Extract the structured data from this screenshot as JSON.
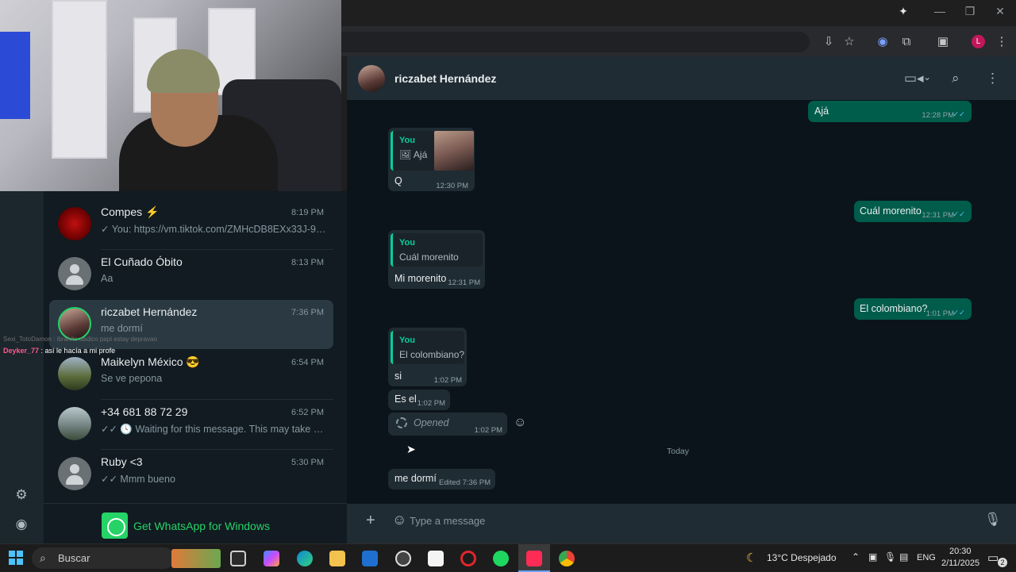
{
  "browser": {
    "window_controls": {
      "minimize": "—",
      "maximize": "❐",
      "close": "✕"
    },
    "profile_initial": "L"
  },
  "webcam_overlay": {
    "line1": "Sexi_TotoDamon : ibrahito aadico papi estay depravao",
    "line2_user": "Deyker_77",
    "line2_text": " : así le hacía a mi profe"
  },
  "chats": [
    {
      "name": "Compes ⚡",
      "time": "8:19 PM",
      "preview": "✓ You: https://vm.tiktok.com/ZMHcDB8EXx33J-9aP...",
      "avatar": "red"
    },
    {
      "name": "El Cuñado Óbito",
      "time": "8:13 PM",
      "preview": "Aa",
      "avatar": "default"
    },
    {
      "name": "riczabet Hernández",
      "time": "7:36 PM",
      "preview": "me dormí",
      "avatar": "photo"
    },
    {
      "name": "Maikelyn México 😎",
      "time": "6:54 PM",
      "preview": "Se ve pepona",
      "avatar": "photo"
    },
    {
      "name": "+34 681 88 72 29",
      "time": "6:52 PM",
      "preview": "✓✓ 🕓 Waiting for this message. This may take a while.",
      "avatar": "photo"
    },
    {
      "name": "Ruby <3",
      "time": "5:30 PM",
      "preview": "✓✓ Mmm bueno",
      "avatar": "default"
    }
  ],
  "get_whatsapp": "Get WhatsApp for Windows",
  "conversation": {
    "contact_name": "riczabet Hernández",
    "messages": {
      "m1_text": "Ajá",
      "m1_time": "12:28 PM",
      "m2_quote_who": "You",
      "m2_quote_text": "🖼 Ajá",
      "m2_text": "Q",
      "m2_time": "12:30 PM",
      "m3_text": "Cuál morenito",
      "m3_time": "12:31 PM",
      "m4_quote_who": "You",
      "m4_quote_text": "Cuál morenito",
      "m4_text": "Mi morenito",
      "m4_time": "12:31 PM",
      "m5_text": "El colombiano?",
      "m5_time": "1:01 PM",
      "m6_quote_who": "You",
      "m6_quote_text": "El colombiano?",
      "m6_text": "si",
      "m6_time": "1:02 PM",
      "m7_text": "Es el",
      "m7_time": "1:02 PM",
      "m8_text": "Opened",
      "m8_time": "1:02 PM",
      "day_label": "Today",
      "m9_text": "me dormí",
      "m9_time": "Edited 7:36 PM"
    },
    "input_placeholder": "Type a message"
  },
  "taskbar": {
    "search_label": "Buscar",
    "weather": "13°C  Despejado",
    "lang": "ENG",
    "time": "20:30",
    "date": "2/11/2025",
    "notif_count": "2"
  },
  "colors": {
    "outgoing": "#005c4b",
    "incoming": "#202c33",
    "accent": "#25d366",
    "ticks": "#53bdeb"
  }
}
